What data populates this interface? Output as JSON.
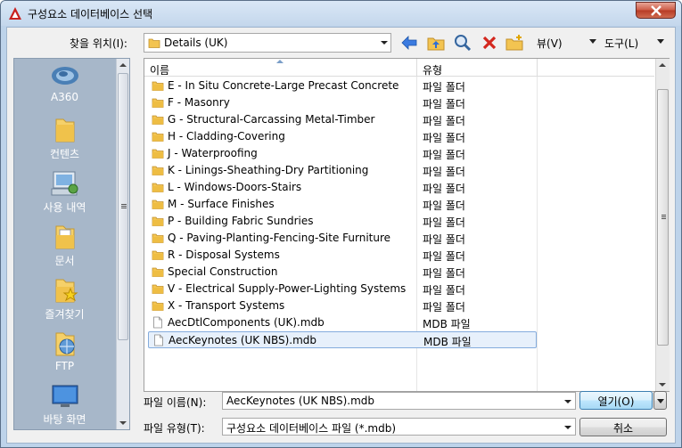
{
  "window": {
    "title": "구성요소 데이터베이스 선택"
  },
  "toolbar": {
    "lookin_label": "찾을 위치(I):",
    "lookin_value": "Details (UK)",
    "views_label": "뷰(V)",
    "tools_label": "도구(L)"
  },
  "places": [
    {
      "label": "A360",
      "icon": "cloud-icon"
    },
    {
      "label": "컨텐츠",
      "icon": "folder-icon"
    },
    {
      "label": "사용 내역",
      "icon": "history-icon"
    },
    {
      "label": "문서",
      "icon": "documents-icon"
    },
    {
      "label": "즐겨찾기",
      "icon": "favorites-icon"
    },
    {
      "label": "FTP",
      "icon": "ftp-icon"
    },
    {
      "label": "바탕 화면",
      "icon": "desktop-icon"
    }
  ],
  "filelist": {
    "col_name": "이름",
    "col_type": "유형",
    "rows": [
      {
        "name": "E - In Situ Concrete-Large Precast Concrete",
        "type": "파일 폴더",
        "icon": "folder-icon"
      },
      {
        "name": "F - Masonry",
        "type": "파일 폴더",
        "icon": "folder-icon"
      },
      {
        "name": "G - Structural-Carcassing Metal-Timber",
        "type": "파일 폴더",
        "icon": "folder-icon"
      },
      {
        "name": "H - Cladding-Covering",
        "type": "파일 폴더",
        "icon": "folder-icon"
      },
      {
        "name": "J - Waterproofing",
        "type": "파일 폴더",
        "icon": "folder-icon"
      },
      {
        "name": "K - Linings-Sheathing-Dry Partitioning",
        "type": "파일 폴더",
        "icon": "folder-icon"
      },
      {
        "name": "L - Windows-Doors-Stairs",
        "type": "파일 폴더",
        "icon": "folder-icon"
      },
      {
        "name": "M - Surface Finishes",
        "type": "파일 폴더",
        "icon": "folder-icon"
      },
      {
        "name": "P - Building Fabric Sundries",
        "type": "파일 폴더",
        "icon": "folder-icon"
      },
      {
        "name": "Q - Paving-Planting-Fencing-Site Furniture",
        "type": "파일 폴더",
        "icon": "folder-icon"
      },
      {
        "name": "R - Disposal Systems",
        "type": "파일 폴더",
        "icon": "folder-icon"
      },
      {
        "name": "Special Construction",
        "type": "파일 폴더",
        "icon": "folder-icon"
      },
      {
        "name": "V - Electrical Supply-Power-Lighting Systems",
        "type": "파일 폴더",
        "icon": "folder-icon"
      },
      {
        "name": "X - Transport Systems",
        "type": "파일 폴더",
        "icon": "folder-icon"
      },
      {
        "name": "AecDtlComponents (UK).mdb",
        "type": "MDB 파일",
        "icon": "file-icon"
      },
      {
        "name": "AecKeynotes (UK NBS).mdb",
        "type": "MDB 파일",
        "icon": "file-icon",
        "selected": true
      }
    ]
  },
  "footer": {
    "filename_label": "파일 이름(N):",
    "filename_value": "AecKeynotes (UK NBS).mdb",
    "filetype_label": "파일 유형(T):",
    "filetype_value": "구성요소 데이터베이스 파일 (*.mdb)",
    "open_label": "열기(O)",
    "cancel_label": "취소"
  },
  "colors": {
    "titlebar": "#c4d7ec",
    "selection": "#e7f0fb",
    "places_bg": "#a7b7c9",
    "close_button": "#cd5a45"
  }
}
